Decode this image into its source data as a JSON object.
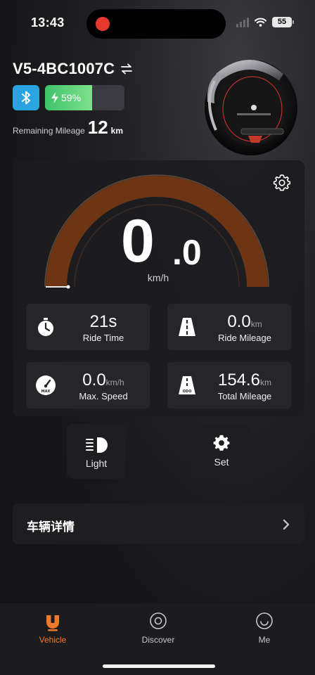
{
  "status_bar": {
    "time": "13:43",
    "battery": "55"
  },
  "device": {
    "name": "V5-4BC1007C",
    "battery_percent": 59,
    "battery_label": "59%",
    "remaining_label": "Remaining Mileage",
    "remaining_value": "12",
    "remaining_unit": "km"
  },
  "speedometer": {
    "integer": "0",
    "decimal": ".0",
    "unit": "km/h"
  },
  "stats": [
    {
      "value": "21s",
      "unit": "",
      "label": "Ride Time",
      "icon": "stopwatch-icon"
    },
    {
      "value": "0.0",
      "unit": "km",
      "label": "Ride Mileage",
      "icon": "road-icon"
    },
    {
      "value": "0.0",
      "unit": "km/h",
      "label": "Max. Speed",
      "icon": "speedometer-icon"
    },
    {
      "value": "154.6",
      "unit": "km",
      "label": "Total Mileage",
      "icon": "odometer-road-icon"
    }
  ],
  "actions": {
    "light": "Light",
    "set": "Set"
  },
  "detail": {
    "label": "车辆详情"
  },
  "tabs": [
    {
      "label": "Vehicle",
      "active": true
    },
    {
      "label": "Discover",
      "active": false
    },
    {
      "label": "Me",
      "active": false
    }
  ],
  "colors": {
    "accent": "#f07a2a",
    "gauge": "#6e3514",
    "bluetooth": "#2aa4e0",
    "battery": "#3ec46b",
    "record": "#e8392e"
  }
}
